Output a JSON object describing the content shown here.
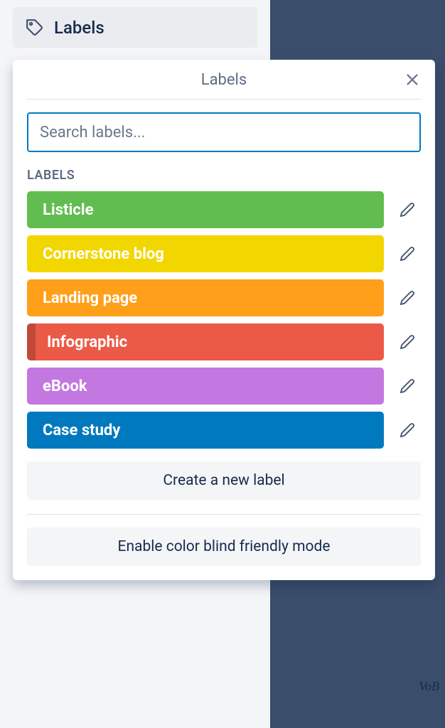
{
  "labels_row": {
    "title": "Labels"
  },
  "popover": {
    "title": "Labels",
    "search_placeholder": "Search labels...",
    "section_heading": "LABELS",
    "create_button": "Create a new label",
    "colorblind_button": "Enable color blind friendly mode"
  },
  "labels": [
    {
      "name": "Listicle",
      "color": "#61bd4f",
      "indented": false
    },
    {
      "name": "Cornerstone blog",
      "color": "#f2d600",
      "indented": false
    },
    {
      "name": "Landing page",
      "color": "#ff9f1a",
      "indented": false
    },
    {
      "name": "Infographic",
      "color": "#eb5a46",
      "indented": true
    },
    {
      "name": "eBook",
      "color": "#c377e0",
      "indented": false
    },
    {
      "name": "Case study",
      "color": "#0079bf",
      "indented": false
    }
  ],
  "signature": "VoB"
}
